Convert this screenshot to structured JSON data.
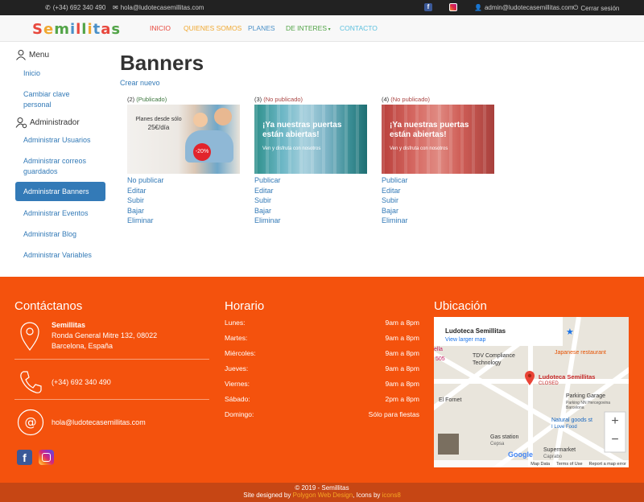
{
  "topbar": {
    "phone": "(+34) 692 340 490",
    "email": "hola@ludotecasemillitas.com",
    "admin_email": "admin@ludotecasemillitas.com",
    "logout": "Cerrar sesión",
    "colors": {
      "bg": "#222222",
      "facebook": "#3b5998",
      "instagram": "#d6249f"
    }
  },
  "nav": {
    "logo_letters": [
      "S",
      "e",
      "m",
      "i",
      "l",
      "l",
      "i",
      "t",
      "a",
      "s"
    ],
    "items": [
      {
        "label": "INICIO",
        "color": "#e8473c"
      },
      {
        "label": "QUIENES SOMOS",
        "color": "#f0a830"
      },
      {
        "label": "PLANES",
        "color": "#4a90c8"
      },
      {
        "label": "DE INTERES",
        "color": "#52a447"
      },
      {
        "label": "CONTACTO",
        "color": "#5bc0de"
      }
    ]
  },
  "sidebar": {
    "menu_title": "Menu",
    "menu_items": [
      "Inicio",
      "Cambiar clave personal"
    ],
    "admin_title": "Administrador",
    "admin_items": [
      "Administrar Usuarios",
      "Administrar correos guardados",
      "Administrar Banners",
      "Administrar Eventos",
      "Administrar Blog",
      "Administrar Variables"
    ]
  },
  "main": {
    "title": "Banners",
    "create_new": "Crear nuevo",
    "banners": [
      {
        "id": "(2)",
        "status": "(Publicado)",
        "img_text": [
          "Planes desde sólo",
          "25€/día",
          "-20%"
        ],
        "actions": [
          "No publicar",
          "Editar",
          "Subir",
          "Bajar",
          "Eliminar"
        ]
      },
      {
        "id": "(3)",
        "status": "(No publicado)",
        "img_text": [
          "¡Ya nuestras puertas",
          "están abiertas!",
          "Ven y disfruta con nosotros"
        ],
        "actions": [
          "Publicar",
          "Editar",
          "Subir",
          "Bajar",
          "Eliminar"
        ]
      },
      {
        "id": "(4)",
        "status": "(No publicado)",
        "img_text": [
          "¡Ya nuestras puertas",
          "están abiertas!",
          "Ven y disfruta con nosotros"
        ],
        "actions": [
          "Publicar",
          "Editar",
          "Subir",
          "Bajar",
          "Eliminar"
        ]
      }
    ]
  },
  "footer": {
    "contact_title": "Contáctanos",
    "company": "Semillitas",
    "address_line1": "Ronda General Mitre 132, 08022",
    "address_line2": "Barcelona, España",
    "phone": "(+34) 692 340 490",
    "email": "hola@ludotecasemillitas.com",
    "hours_title": "Horario",
    "hours": [
      {
        "day": "Lunes:",
        "time": "9am a 8pm"
      },
      {
        "day": "Martes:",
        "time": "9am a 8pm"
      },
      {
        "day": "Miércoles:",
        "time": "9am a 8pm"
      },
      {
        "day": "Jueves:",
        "time": "9am a 8pm"
      },
      {
        "day": "Viernes:",
        "time": "9am a 8pm"
      },
      {
        "day": "Sábado:",
        "time": "2pm a 8pm"
      },
      {
        "day": "Domingo:",
        "time": "Sólo para fiestas"
      }
    ],
    "location_title": "Ubicación",
    "map": {
      "place": "Ludoteca Semillitas",
      "larger_map": "View larger map",
      "pin_label": "Ludoteca Semillitas",
      "pin_status": "CLOSED",
      "pois": [
        "TDV Compliance Technology",
        "Japanese restaurant",
        "El Fornet",
        "Parking Garage",
        "Parking NN Hercegovina Barcelona",
        "Natural goods st",
        "I Love Food",
        "Gas station",
        "Cepsa",
        "Supermarket",
        "Caprabo"
      ],
      "labels": [
        "ella",
        "505"
      ],
      "footer": [
        "Map Data",
        "Terms of Use",
        "Report a map error"
      ],
      "google": "Google"
    },
    "copyright": "© 2019 - Semillitas",
    "credits_prefix": "Site designed by",
    "credits_designer": "Polygon Web Design",
    "credits_mid": ", Icons by",
    "credits_icons": "icons8",
    "colors": {
      "bg": "#f4520d",
      "bottom": "#c64614"
    }
  }
}
